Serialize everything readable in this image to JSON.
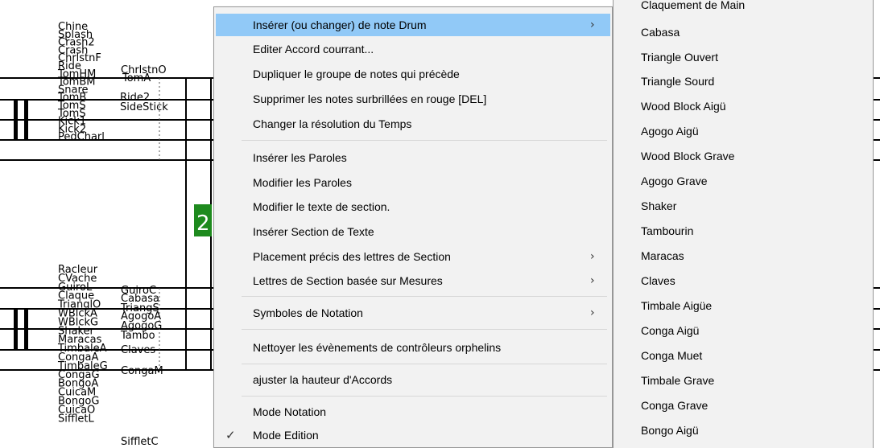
{
  "staff": {
    "upper": {
      "col1": [
        "Chine",
        "Splash",
        "Crash2",
        "Crash",
        "ChrlstnF",
        "Ride",
        "TomHM",
        "TomBM",
        "Snare",
        "TomB",
        "TomS",
        "TomS",
        "Kick1",
        "Kick2",
        "PedCharl"
      ],
      "col2": [
        "ChrlstnO",
        "TomA",
        "Ride2",
        "SideStick"
      ]
    },
    "lower": {
      "col1": [
        "Racleur",
        "CVache",
        "GuiroL",
        "Claque",
        "TrianglO",
        "WBlckA",
        "WBlckG",
        "Shaker",
        "Maracas",
        "TimbaleA",
        "CongaA",
        "TimbaleG",
        "CongaG",
        "BongoA",
        "CuicaM",
        "BongoG",
        "CuicaO",
        "SiffletL"
      ],
      "col2": [
        "GuiroC",
        "Cabasa",
        "TriangS",
        "AgogoA",
        "AgogoG",
        "Tambo",
        "Claves",
        "CongaM",
        "SiffletC"
      ]
    },
    "measure_marker": "2"
  },
  "context_menu": {
    "items": [
      {
        "label": "Insérer (ou changer) de note Drum",
        "submenu": true,
        "highlighted": true
      },
      {
        "label": "Editer Accord courrant..."
      },
      {
        "label": "Dupliquer le groupe de notes qui précède"
      },
      {
        "label": "Supprimer les notes surbrillées en rouge  [DEL]"
      },
      {
        "label": "Changer la résolution du Temps"
      },
      {
        "label": "Insérer les Paroles"
      },
      {
        "label": "Modifier les Paroles"
      },
      {
        "label": "Modifier le texte de section."
      },
      {
        "label": "Insérer Section de Texte"
      },
      {
        "label": "Placement précis des lettres de Section",
        "submenu": true
      },
      {
        "label": "Lettres de Section basée sur Mesures",
        "submenu": true
      },
      {
        "label": "Symboles de Notation",
        "submenu": true
      },
      {
        "label": "Nettoyer les évènements de contrôleurs orphelins"
      },
      {
        "label": "ajuster la hauteur d'Accords"
      },
      {
        "label": "Mode Notation"
      },
      {
        "label": "Mode Edition",
        "checked": true
      }
    ],
    "arrow_glyph": "›",
    "check_glyph": "✓"
  },
  "drum_submenu": {
    "items": [
      "Claquement de Main",
      "Cabasa",
      "Triangle Ouvert",
      "Triangle Sourd",
      "Wood Block Aigü",
      "Agogo Aigü",
      "Wood Block Grave",
      "Agogo Grave",
      "Shaker",
      "Tambourin",
      "Maracas",
      "Claves",
      "Timbale Aigüe",
      "Conga Aigü",
      "Conga Muet",
      "Timbale Grave",
      "Conga Grave",
      "Bongo Aigü"
    ]
  },
  "colors": {
    "highlight": "#91c9f7",
    "menu_bg": "#f2f2f2",
    "marker_green": "#1e8a1e"
  }
}
